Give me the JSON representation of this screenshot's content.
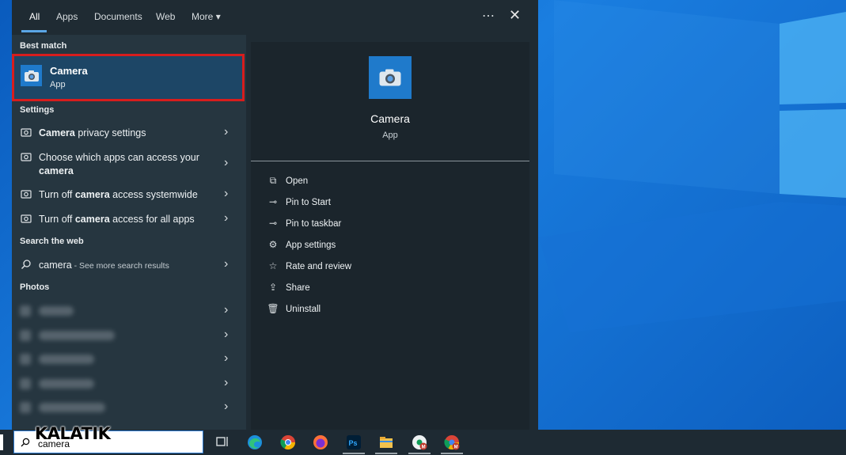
{
  "tabs": [
    {
      "label": "All"
    },
    {
      "label": "Apps"
    },
    {
      "label": "Documents"
    },
    {
      "label": "Web"
    },
    {
      "label": "More"
    }
  ],
  "toolbar": {
    "more_glyph": "⋯",
    "close_glyph": "✕",
    "more_caret": "▾"
  },
  "sections": {
    "best_match": "Best match",
    "settings": "Settings",
    "search_web": "Search the web",
    "photos": "Photos"
  },
  "best_match": {
    "title": "Camera",
    "subtitle": "App"
  },
  "settings_items": [
    {
      "bold": "Camera",
      "rest": " privacy settings"
    },
    {
      "line1": "Choose which apps can access your",
      "line2": "camera"
    },
    {
      "pre": "Turn off ",
      "bold": "camera",
      "rest": " access systemwide"
    },
    {
      "pre": "Turn off ",
      "bold": "camera",
      "rest": " access for all apps"
    }
  ],
  "web_search": {
    "query": "camera",
    "suffix": " - See more search results"
  },
  "detail": {
    "title": "Camera",
    "subtitle": "App",
    "actions": [
      {
        "label": "Open",
        "icon": "open-icon",
        "glyph": "⧉"
      },
      {
        "label": "Pin to Start",
        "icon": "pin-icon",
        "glyph": "⊸"
      },
      {
        "label": "Pin to taskbar",
        "icon": "pin-icon",
        "glyph": "⊸"
      },
      {
        "label": "App settings",
        "icon": "gear-icon",
        "glyph": "⚙"
      },
      {
        "label": "Rate and review",
        "icon": "star-icon",
        "glyph": "☆"
      },
      {
        "label": "Share",
        "icon": "share-icon",
        "glyph": "⇪"
      },
      {
        "label": "Uninstall",
        "icon": "trash-icon",
        "glyph": "🗑"
      }
    ]
  },
  "taskbar": {
    "search_value": "camera",
    "watermark": "KALATIK",
    "apps": [
      "task-view",
      "edge",
      "chrome",
      "firefox",
      "photoshop",
      "file-explorer",
      "chrome-profile-m",
      "chrome-profile-m"
    ]
  },
  "colors": {
    "accent": "#1f7acb",
    "highlight_border": "#d71d1d",
    "panel": "#1f2b33"
  }
}
